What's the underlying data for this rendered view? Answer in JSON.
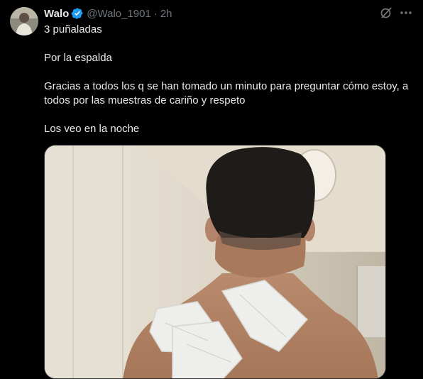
{
  "tweet": {
    "author_name": "Walo",
    "handle": "@Walo_1901",
    "separator": "·",
    "time": "2h",
    "lines": [
      "3 puñaladas",
      "Por la espalda",
      "Gracias a todos los q se han tomado un minuto para preguntar cómo estoy, a todos por las muestras de cariño y respeto",
      "Los veo en la noche"
    ]
  },
  "icons": {
    "verified": "verified-badge-icon",
    "grok": "grok-icon",
    "more": "more-options-icon"
  },
  "colors": {
    "background": "#000000",
    "text": "#e7e9ea",
    "secondary_text": "#71767b",
    "verified": "#1d9bf0"
  }
}
